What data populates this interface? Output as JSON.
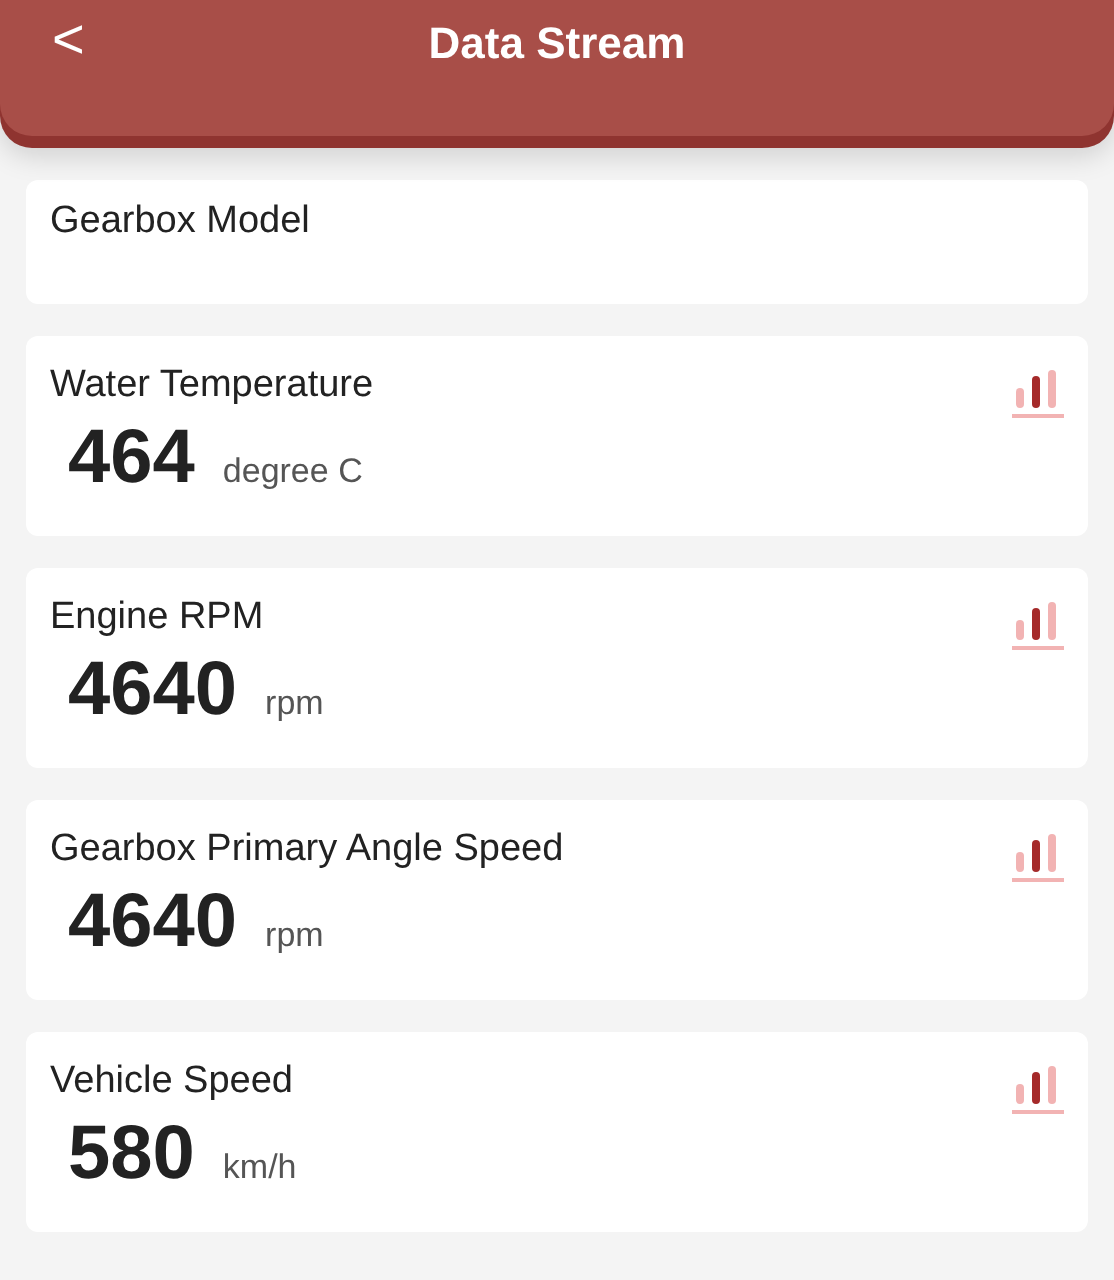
{
  "header": {
    "back": "<",
    "title": "Data Stream"
  },
  "model": {
    "label": "Gearbox Model"
  },
  "readings": [
    {
      "name": "Water Temperature",
      "value": "464",
      "unit": "degree C"
    },
    {
      "name": "Engine RPM",
      "value": "4640",
      "unit": "rpm"
    },
    {
      "name": "Gearbox Primary Angle Speed",
      "value": "4640",
      "unit": "rpm"
    },
    {
      "name": "Vehicle Speed",
      "value": "580",
      "unit": "km/h"
    }
  ]
}
